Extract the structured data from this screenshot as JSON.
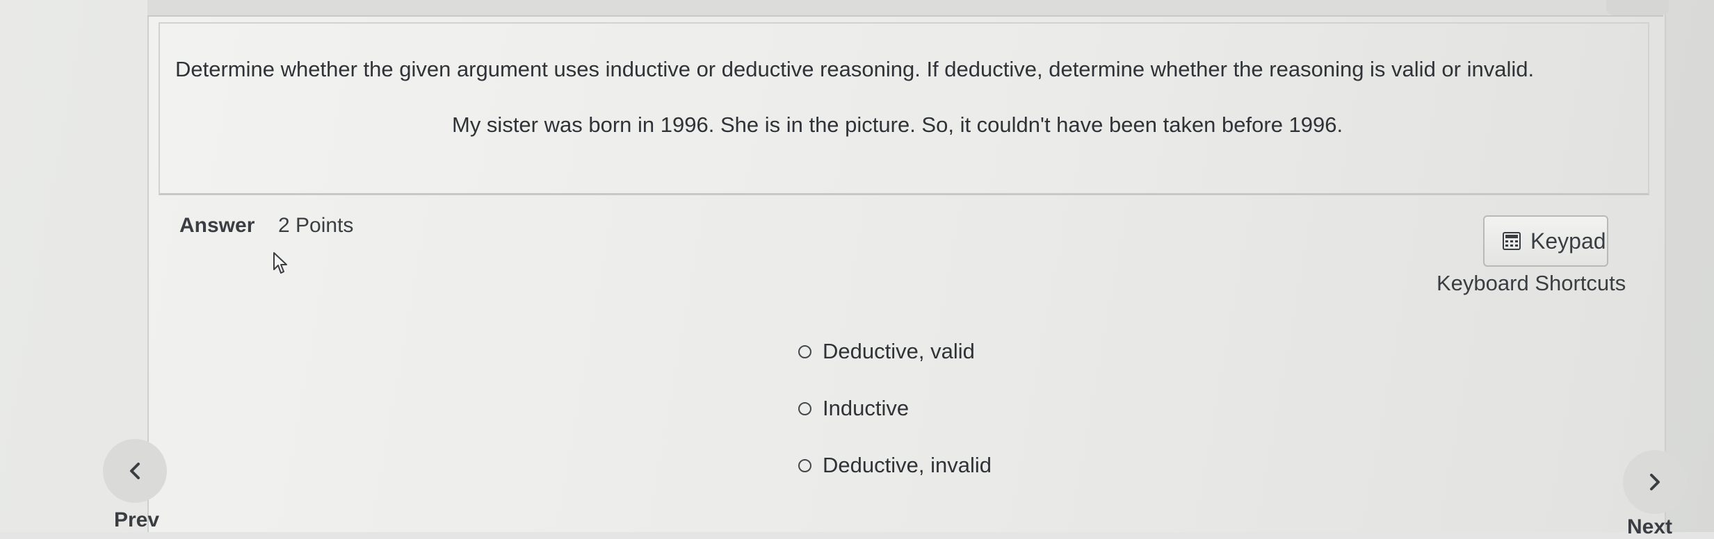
{
  "question": {
    "prompt": "Determine whether the given argument uses inductive or deductive reasoning. If deductive, determine whether the reasoning is valid or invalid.",
    "argument": "My sister was born in 1996. She is in the picture. So, it couldn't have been taken before 1996."
  },
  "answer": {
    "label": "Answer",
    "points": "2 Points"
  },
  "tools": {
    "keypad_label": "Keypad",
    "keypad_icon": "calculator-icon",
    "shortcuts_label": "Keyboard Shortcuts"
  },
  "options": [
    {
      "label": "Deductive, valid",
      "selected": false
    },
    {
      "label": "Inductive",
      "selected": false
    },
    {
      "label": "Deductive, invalid",
      "selected": false
    }
  ],
  "nav": {
    "prev_label": "Prev",
    "next_label": "Next",
    "prev_icon": "chevron-left-icon",
    "next_icon": "chevron-right-icon"
  }
}
